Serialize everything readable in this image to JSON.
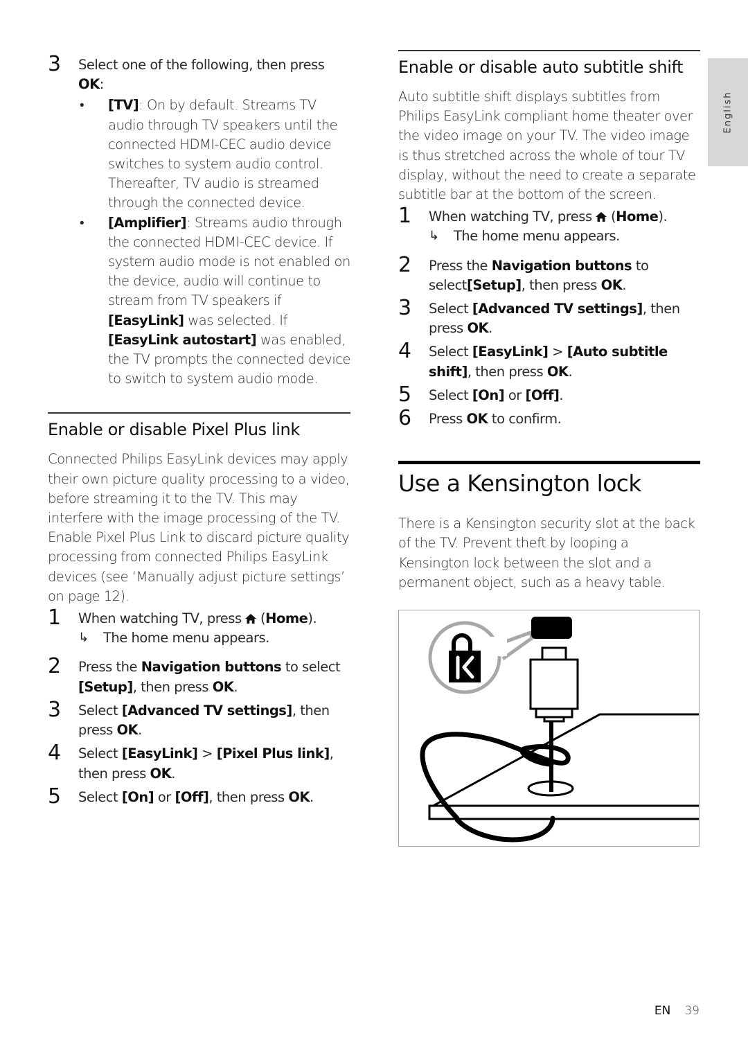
{
  "side_tab": {
    "label": "English"
  },
  "left_column": {
    "step3_intro": {
      "number": "3",
      "text_a": "Select one of the following, then press ",
      "text_ok": "OK",
      "text_b": ":"
    },
    "options": [
      {
        "bold": "[TV]",
        "text": ": On by default. Streams TV audio through TV speakers until the connected HDMI-CEC audio device switches to system audio control. Thereafter, TV audio is streamed through the connected device."
      },
      {
        "bold": "[Amplifier]",
        "text": ": Streams audio through the connected HDMI-CEC device. If system audio mode is not enabled on the device, audio will continue to stream from TV speakers if ",
        "bold2": "[EasyLink]",
        "text2": " was selected. If ",
        "bold3": "[EasyLink autostart]",
        "text3": " was enabled, the TV prompts the connected device to switch to system audio mode."
      }
    ],
    "section": {
      "heading": "Enable or disable Pixel Plus link",
      "intro": "Connected Philips EasyLink devices may apply their own picture quality processing to a video, before streaming it to the TV. This may interfere with the image processing of the TV. Enable Pixel Plus Link to discard picture quality processing from connected Philips EasyLink devices (see ‘Manually adjust picture settings’ on page 12).",
      "steps": [
        {
          "number": "1",
          "a": "When watching TV, press ",
          "icon": "home-icon",
          "b": " (",
          "bold": "Home",
          "c": ").",
          "result_arrow": "↳",
          "result": "The home menu appears."
        },
        {
          "number": "2",
          "a": "Press the ",
          "bold": "Navigation buttons",
          "b": " to select ",
          "bold2": "[Setup]",
          "c": ", then press ",
          "bold3": "OK",
          "d": "."
        },
        {
          "number": "3",
          "a": "Select ",
          "bold": "[Advanced TV settings]",
          "b": ", then press ",
          "bold2": "OK",
          "c": "."
        },
        {
          "number": "4",
          "a": "Select ",
          "bold": "[EasyLink]",
          "b": " > ",
          "bold2": "[Pixel Plus link]",
          "c": ", then press ",
          "bold3": "OK",
          "d": "."
        },
        {
          "number": "5",
          "a": "Select ",
          "bold": "[On]",
          "b": " or ",
          "bold2": "[Off]",
          "c": ", then press ",
          "bold3": "OK",
          "d": "."
        }
      ]
    }
  },
  "right_column": {
    "subtitle_section": {
      "heading": "Enable or disable auto subtitle shift",
      "intro": "Auto subtitle shift displays subtitles from Philips EasyLink compliant home theater over the video image on your TV. The video image is thus stretched across the whole of tour TV display, without the need to create a separate subtitle bar at the bottom of the screen.",
      "steps": [
        {
          "number": "1",
          "a": "When watching TV, press ",
          "icon": "home-icon",
          "b": " (",
          "bold": "Home",
          "c": ").",
          "result_arrow": "↳",
          "result": "The home menu appears."
        },
        {
          "number": "2",
          "a": "Press the ",
          "bold": "Navigation buttons",
          "b": " to select",
          "bold2": "[Setup]",
          "c": ", then press ",
          "bold3": "OK",
          "d": "."
        },
        {
          "number": "3",
          "a": "Select ",
          "bold": "[Advanced TV settings]",
          "b": ", then press ",
          "bold2": "OK",
          "c": "."
        },
        {
          "number": "4",
          "a": "Select ",
          "bold": "[EasyLink]",
          "b": " > ",
          "bold2": "[Auto subtitle shift]",
          "c": ", then press ",
          "bold3": "OK",
          "d": "."
        },
        {
          "number": "5",
          "a": "Select ",
          "bold": "[On]",
          "b": " or ",
          "bold2": "[Off]",
          "c": "."
        },
        {
          "number": "6",
          "a": "Press ",
          "bold": "OK",
          "b": " to confirm."
        }
      ]
    },
    "kensington_section": {
      "heading": "Use a Kensington lock",
      "intro": "There is a Kensington security slot at the back of the TV. Prevent theft by looping a Kensington lock between the slot and a permanent object, such as a heavy table.",
      "figure": {
        "icon": "kensington-lock-illustration",
        "logo_letter": "K"
      }
    }
  },
  "footer": {
    "language": "EN",
    "page_number": "39"
  }
}
